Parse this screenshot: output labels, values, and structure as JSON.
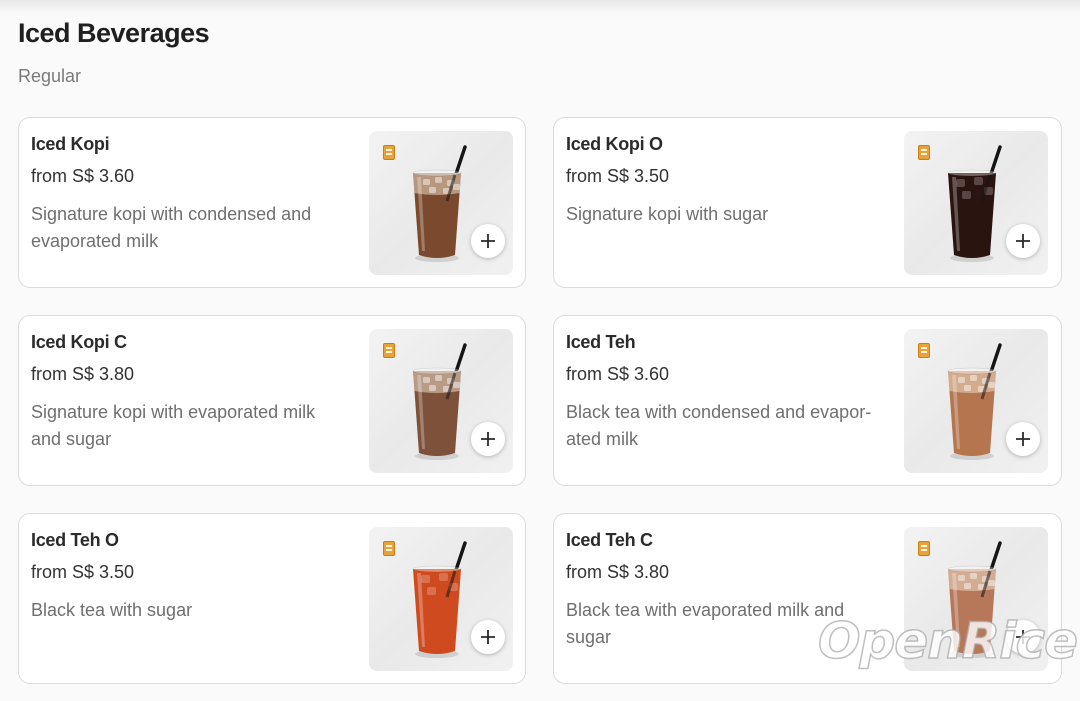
{
  "section": {
    "title": "Iced Beverages",
    "subtitle": "Regular"
  },
  "items": [
    {
      "name": "Iced Kopi",
      "price": "from S$ 3.60",
      "description": "Signature kopi with condensed and evaporated milk",
      "drink_color": "#7b4a2e",
      "has_ice_foam": true
    },
    {
      "name": "Iced Kopi O",
      "price": "from S$ 3.50",
      "description": "Signature kopi with sugar",
      "drink_color": "#2a1410",
      "has_ice_foam": false
    },
    {
      "name": "Iced Kopi C",
      "price": "from S$ 3.80",
      "description": "Signature kopi with evaporated milk and sugar",
      "drink_color": "#7d513a",
      "has_ice_foam": true
    },
    {
      "name": "Iced Teh",
      "price": "from S$ 3.60",
      "description": "Black tea with condensed and evapor- ated milk",
      "drink_color": "#b5754f",
      "has_ice_foam": true
    },
    {
      "name": "Iced Teh O",
      "price": "from S$ 3.50",
      "description": "Black tea with sugar",
      "drink_color": "#cf4a1e",
      "has_ice_foam": false
    },
    {
      "name": "Iced Teh C",
      "price": "from S$ 3.80",
      "description": "Black tea with evaporated milk and sugar",
      "drink_color": "#b7785a",
      "has_ice_foam": true
    }
  ],
  "icons": {
    "add": "plus-icon",
    "brand": "brand-logo-icon",
    "product": "iced-drink-glass-icon"
  },
  "watermark": "OpenRice"
}
